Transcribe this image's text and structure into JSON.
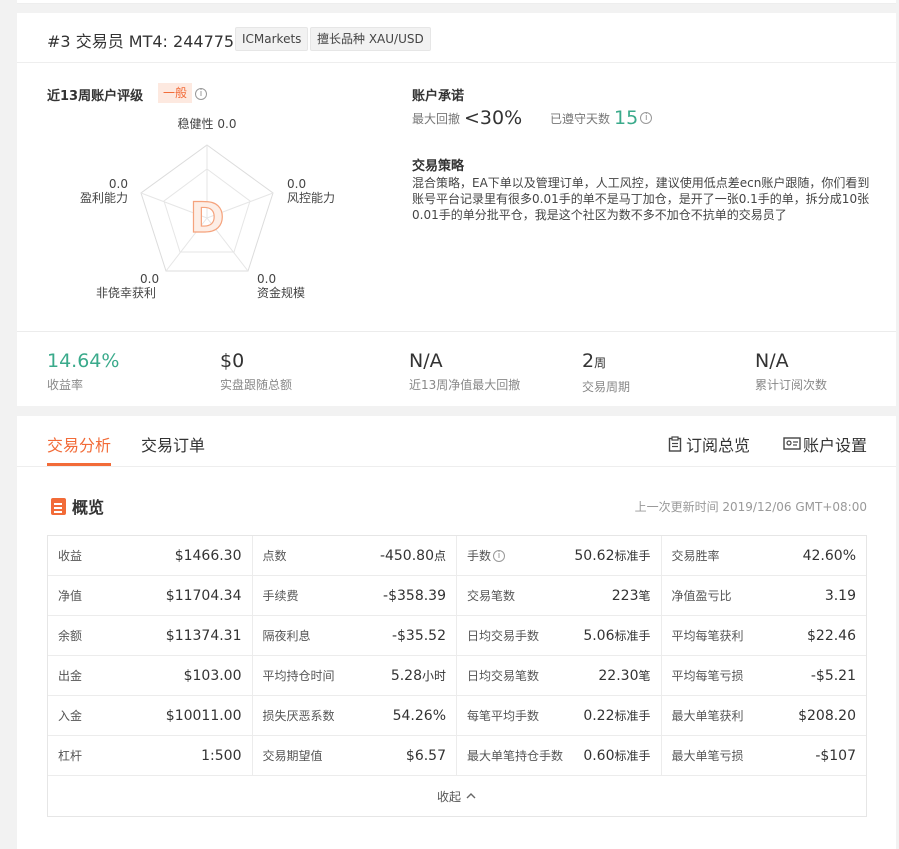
{
  "trader": {
    "rank": "#3",
    "role": "交易员",
    "account": "MT4: 244775",
    "broker": "ICMarkets",
    "specialty": "擅长品种 XAU/USD"
  },
  "rating": {
    "title": "近13周账户评级",
    "grade_label": "一般",
    "grade_letter": "D",
    "axes": [
      {
        "name": "稳健性",
        "value": "0.0"
      },
      {
        "name": "风控能力",
        "value": "0.0"
      },
      {
        "name": "资金规模",
        "value": "0.0"
      },
      {
        "name": "非侥幸获利",
        "value": "0.0"
      },
      {
        "name": "盈利能力",
        "value": "0.0"
      }
    ]
  },
  "promise": {
    "title": "账户承诺",
    "max_drawdown_label": "最大回撤",
    "max_drawdown_value": "<30%",
    "days_label": "已遵守天数",
    "days_value": "15"
  },
  "strategy": {
    "title": "交易策略",
    "text": "混合策略，EA下单以及管理订单，人工风控，建议使用低点差ecn账户跟随，你们看到账号平台记录里有很多0.01手的单不是马丁加仓，是开了一张0.1手的单，拆分成10张0.01手的单分批平仓，我是这个社区为数不多不加仓不抗单的交易员了"
  },
  "stats": [
    {
      "value": "14.64%",
      "unit": "",
      "label": "收益率"
    },
    {
      "value": "$0",
      "unit": "",
      "label": "实盘跟随总额"
    },
    {
      "value": "N/A",
      "unit": "",
      "label": "近13周净值最大回撤"
    },
    {
      "value": "2",
      "unit": "周",
      "label": "交易周期"
    },
    {
      "value": "N/A",
      "unit": "",
      "label": "累计订阅次数"
    }
  ],
  "tabs": {
    "analysis": "交易分析",
    "orders": "交易订单",
    "subscribe_overview": "订阅总览",
    "account_settings": "账户设置"
  },
  "overview": {
    "title": "概览",
    "last_update": "上一次更新时间 2019/12/06 GMT+08:00",
    "collapse": "收起",
    "rows": [
      [
        {
          "k": "收益",
          "v": "$1466.30",
          "u": ""
        },
        {
          "k": "点数",
          "v": "-450.80",
          "u": "点"
        },
        {
          "k": "手数",
          "v": "50.62",
          "u": "标准手",
          "info": true
        },
        {
          "k": "交易胜率",
          "v": "42.60%",
          "u": ""
        }
      ],
      [
        {
          "k": "净值",
          "v": "$11704.34",
          "u": ""
        },
        {
          "k": "手续费",
          "v": "-$358.39",
          "u": ""
        },
        {
          "k": "交易笔数",
          "v": "223",
          "u": "笔"
        },
        {
          "k": "净值盈亏比",
          "v": "3.19",
          "u": ""
        }
      ],
      [
        {
          "k": "余额",
          "v": "$11374.31",
          "u": ""
        },
        {
          "k": "隔夜利息",
          "v": "-$35.52",
          "u": ""
        },
        {
          "k": "日均交易手数",
          "v": "5.06",
          "u": "标准手"
        },
        {
          "k": "平均每笔获利",
          "v": "$22.46",
          "u": ""
        }
      ],
      [
        {
          "k": "出金",
          "v": "$103.00",
          "u": ""
        },
        {
          "k": "平均持仓时间",
          "v": "5.28",
          "u": "小时"
        },
        {
          "k": "日均交易笔数",
          "v": "22.30",
          "u": "笔"
        },
        {
          "k": "平均每笔亏损",
          "v": "-$5.21",
          "u": ""
        }
      ],
      [
        {
          "k": "入金",
          "v": "$10011.00",
          "u": ""
        },
        {
          "k": "损失厌恶系数",
          "v": "54.26%",
          "u": ""
        },
        {
          "k": "每笔平均手数",
          "v": "0.22",
          "u": "标准手"
        },
        {
          "k": "最大单笔获利",
          "v": "$208.20",
          "u": ""
        }
      ],
      [
        {
          "k": "杠杆",
          "v": "1:500",
          "u": ""
        },
        {
          "k": "交易期望值",
          "v": "$6.57",
          "u": ""
        },
        {
          "k": "最大单笔持仓手数",
          "v": "0.60",
          "u": "标准手"
        },
        {
          "k": "最大单笔亏损",
          "v": "-$107",
          "u": ""
        }
      ]
    ]
  },
  "colors": {
    "accent": "#f26b38",
    "green": "#3aaa8b"
  },
  "icons": [
    "info-icon",
    "document-icon",
    "clipboard-icon",
    "account-settings-icon",
    "chevron-up-icon"
  ]
}
